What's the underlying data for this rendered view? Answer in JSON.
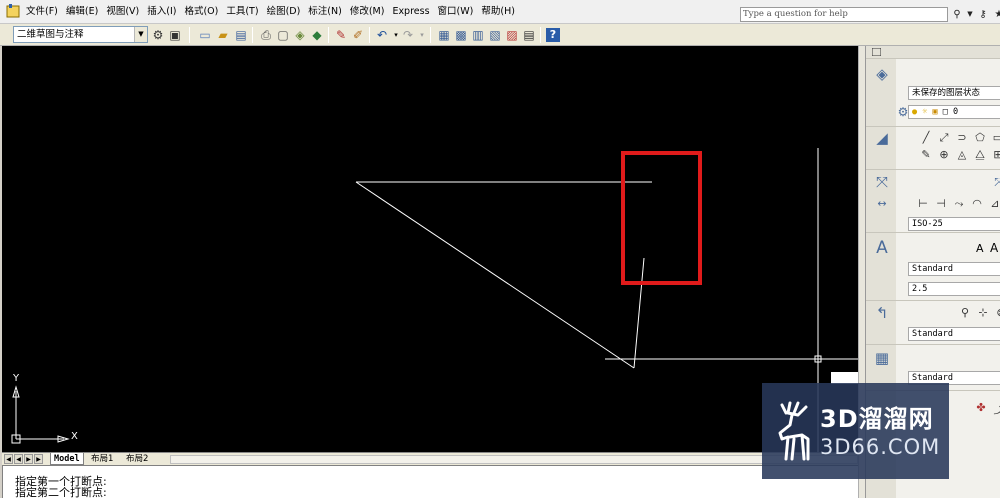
{
  "window": {
    "menus": [
      "文件(F)",
      "编辑(E)",
      "视图(V)",
      "插入(I)",
      "格式(O)",
      "工具(T)",
      "绘图(D)",
      "标注(N)",
      "修改(M)",
      "Express",
      "窗口(W)",
      "帮助(H)"
    ],
    "help_placeholder": "Type a question for help",
    "app_icon": "autocad-app-icon",
    "help_icons": [
      "binoculars-icon",
      "chevron-down-icon",
      "key-icon",
      "star-icon"
    ]
  },
  "toolbar": {
    "workspace": "二维草图与注释",
    "icons": [
      "new-icon",
      "open-icon",
      "save-icon",
      "print-icon",
      "preview-icon",
      "publish-icon",
      "plot-icon",
      "cut-icon",
      "match-prop-icon",
      "undo-icon",
      "redo-icon",
      "properties-icon",
      "design-center-icon",
      "tool-palette-icon",
      "sheet-set-icon",
      "markup-icon",
      "calculator-icon",
      "help-icon"
    ]
  },
  "drawing": {
    "ucs_x": "X",
    "ucs_y": "Y",
    "highlight_color": "#e01b1b",
    "line_color": "#ffffff",
    "background_color": "#000000"
  },
  "tabs": [
    "Model",
    "布局1",
    "布局2"
  ],
  "command_lines": [
    "指定第一个打断点:",
    "指定第二个打断点:"
  ],
  "palette": {
    "layer_state": "未保存的图层状态",
    "layer_current": "0",
    "dim_style": "ISO-25",
    "text_style": "Standard",
    "text_height": "2.5",
    "mleader_style": "Standard",
    "table_style": "Standard",
    "text_size_glyphs": [
      "A",
      "A"
    ]
  },
  "watermark": {
    "title": "3D溜溜网",
    "subtitle": "3D66.COM"
  }
}
